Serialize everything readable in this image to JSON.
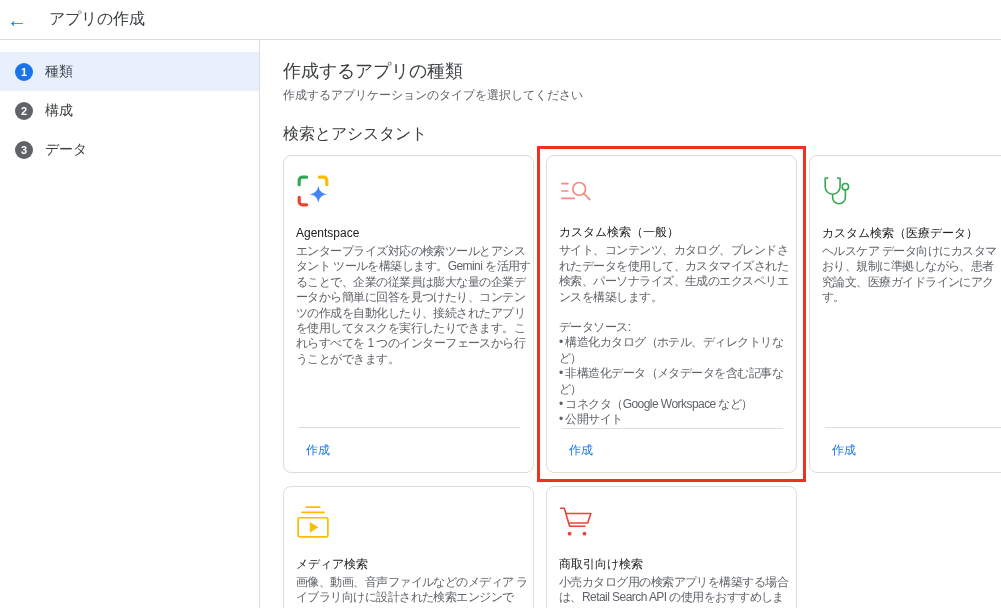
{
  "header": {
    "back_icon": "←",
    "title": "アプリの作成"
  },
  "steps": [
    {
      "number": "1",
      "label": "種類",
      "selected": true
    },
    {
      "number": "2",
      "label": "構成",
      "selected": false
    },
    {
      "number": "3",
      "label": "データ",
      "selected": false
    }
  ],
  "main": {
    "title": "作成するアプリの種類",
    "subtitle": "作成するアプリケーションのタイプを選択してください",
    "section": "検索とアシスタント",
    "cards": [
      {
        "kind": "sparkle",
        "title": "Agentspace",
        "highlighted": false,
        "description": [
          "エンタープライズ対応の検索ツールとアシス",
          "タント ツールを構築します。Gemini を活用す",
          "ることで、企業の従業員は膨大な量の企業デ",
          "ータから簡単に回答を見つけたり、コンテン",
          "ツの作成を自動化したり、接続されたアプリ",
          "を使用してタスクを実行したりできます。こ",
          "れらすべてを 1 つのインターフェースから行",
          "うことができます。"
        ],
        "action": "作成"
      },
      {
        "kind": "search-list",
        "title": "カスタム検索（一般）",
        "highlighted": true,
        "description": [
          "サイト、コンテンツ、カタログ、ブレンドさ",
          "れたデータを使用して、カスタマイズされた",
          "検索、パーソナライズ、生成のエクスペリエ",
          "ンスを構築します。"
        ],
        "sources": [
          "データソース:",
          "• 構造化カタログ（ホテル、ディレクトリな",
          "ど）",
          "• 非構造化データ（メタデータを含む記事な",
          "ど）",
          "• コネクタ（Google Workspace など）",
          "• 公開サイト"
        ],
        "action": "作成"
      },
      {
        "kind": "stethoscope",
        "title": "カスタム検索（医療データ）",
        "highlighted": false,
        "description": [
          "ヘルスケア データ向けにカスタマ",
          "おり、規制に準拠しながら、患者",
          "究論文、医療ガイドラインにアク",
          "す。"
        ],
        "action": "作成"
      },
      {
        "kind": "media",
        "title": "メディア検索",
        "highlighted": false,
        "description": [
          "画像、動画、音声ファイルなどのメディア ラ",
          "イブラリ向けに設計された検索エンジンで"
        ]
      },
      {
        "kind": "cart",
        "title": "商取引向け検索",
        "highlighted": false,
        "description": [
          "小売カタログ用の検索アプリを構築する場合",
          "は、Retail Search API の使用をおすすめしま"
        ]
      }
    ]
  }
}
